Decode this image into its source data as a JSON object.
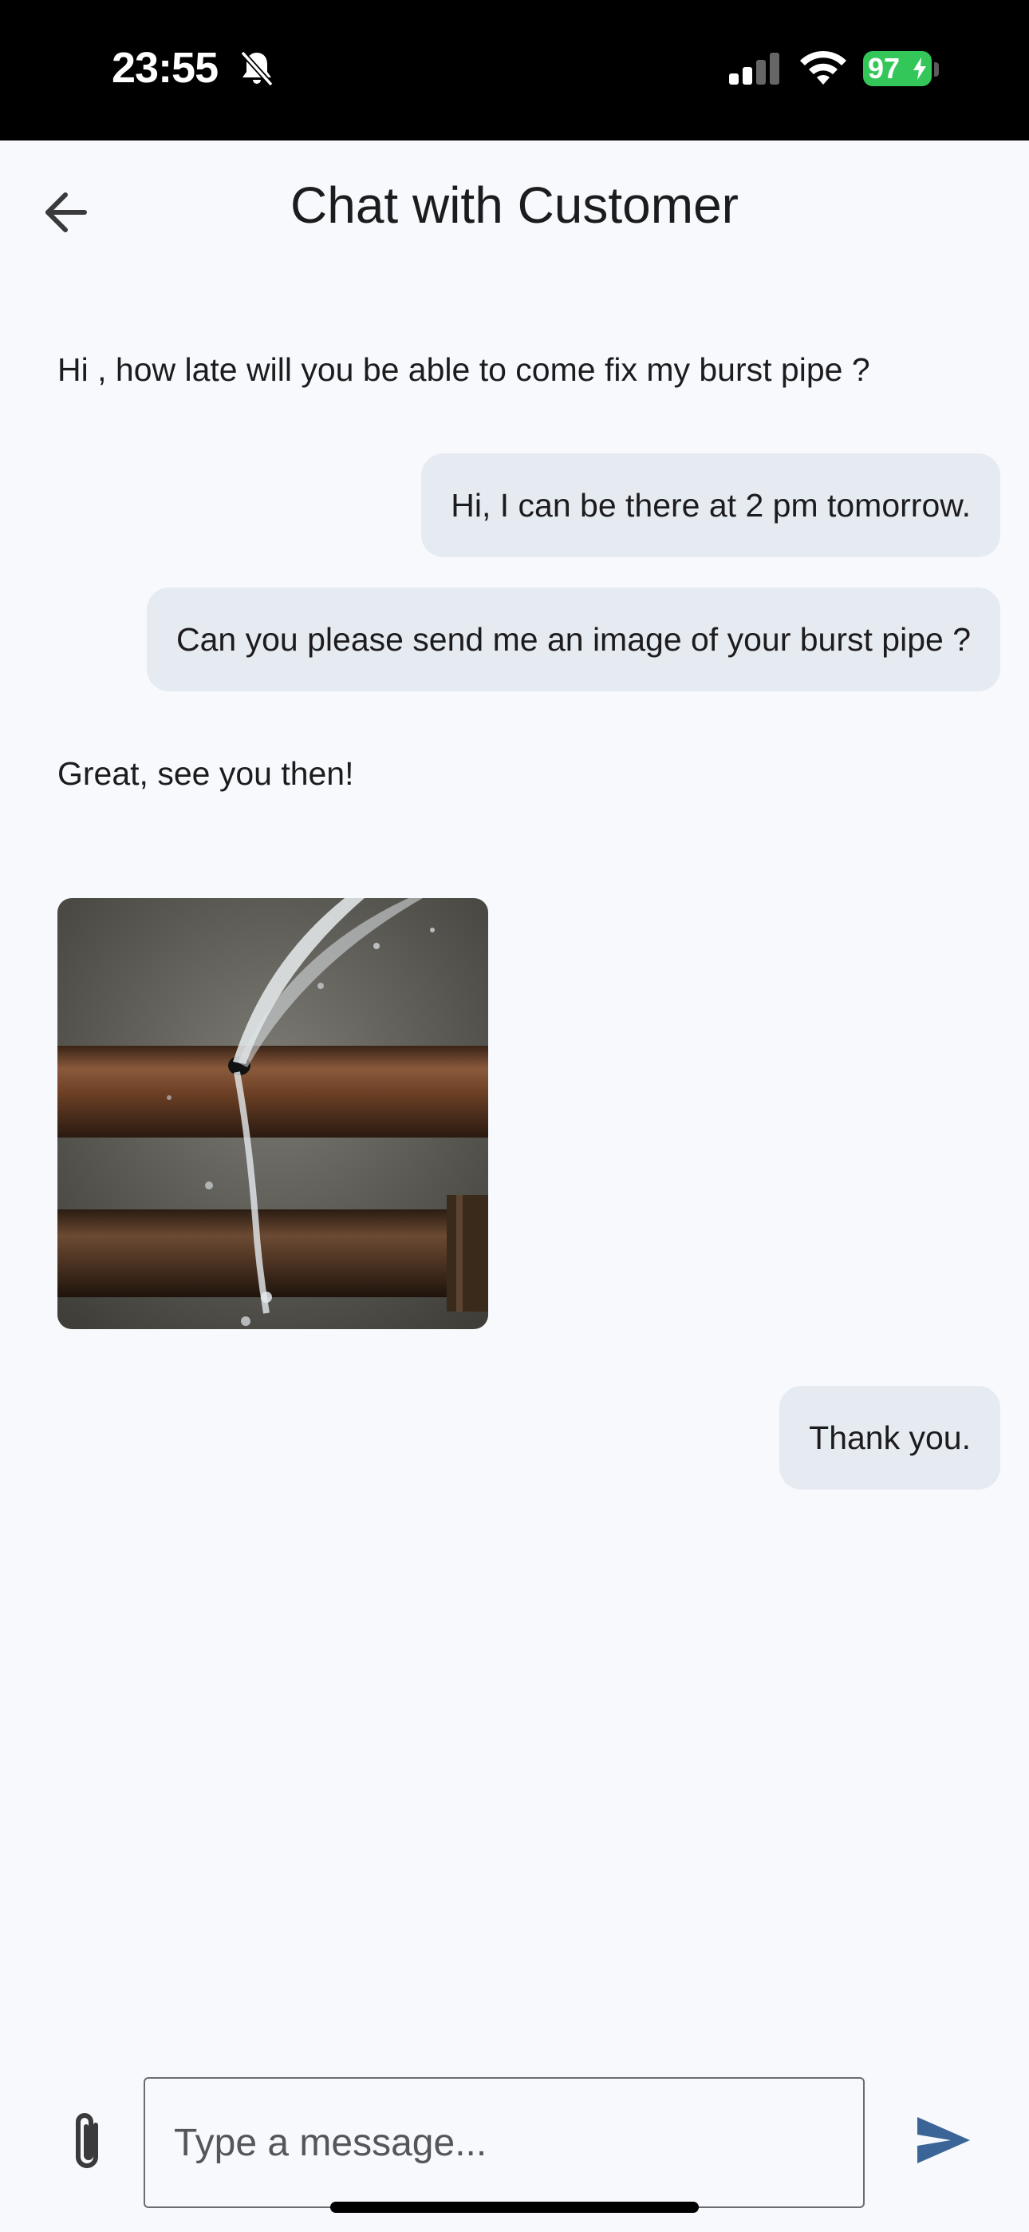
{
  "status_bar": {
    "time": "23:55",
    "battery": "97"
  },
  "header": {
    "title": "Chat with Customer"
  },
  "messages": [
    {
      "side": "left",
      "text": "Hi , how late will you be able to come fix my burst pipe ?"
    },
    {
      "side": "right",
      "text": "Hi, I can be there at 2 pm tomorrow."
    },
    {
      "side": "right",
      "text": "Can you please send me an image of your burst pipe ?"
    },
    {
      "side": "left",
      "text": "Great, see you then!"
    },
    {
      "side": "left",
      "type": "image",
      "description": "burst-pipe-photo"
    },
    {
      "side": "right",
      "text": "Thank you."
    }
  ],
  "composer": {
    "placeholder": "Type a message..."
  },
  "colors": {
    "background": "#f7f9fd",
    "bubble": "#e6eaf1",
    "send_icon": "#3b6596",
    "battery": "#33c759"
  },
  "icons": [
    "back-arrow-icon",
    "paperclip-icon",
    "send-icon",
    "bell-slash-icon",
    "signal-icon",
    "wifi-icon",
    "battery-icon"
  ]
}
